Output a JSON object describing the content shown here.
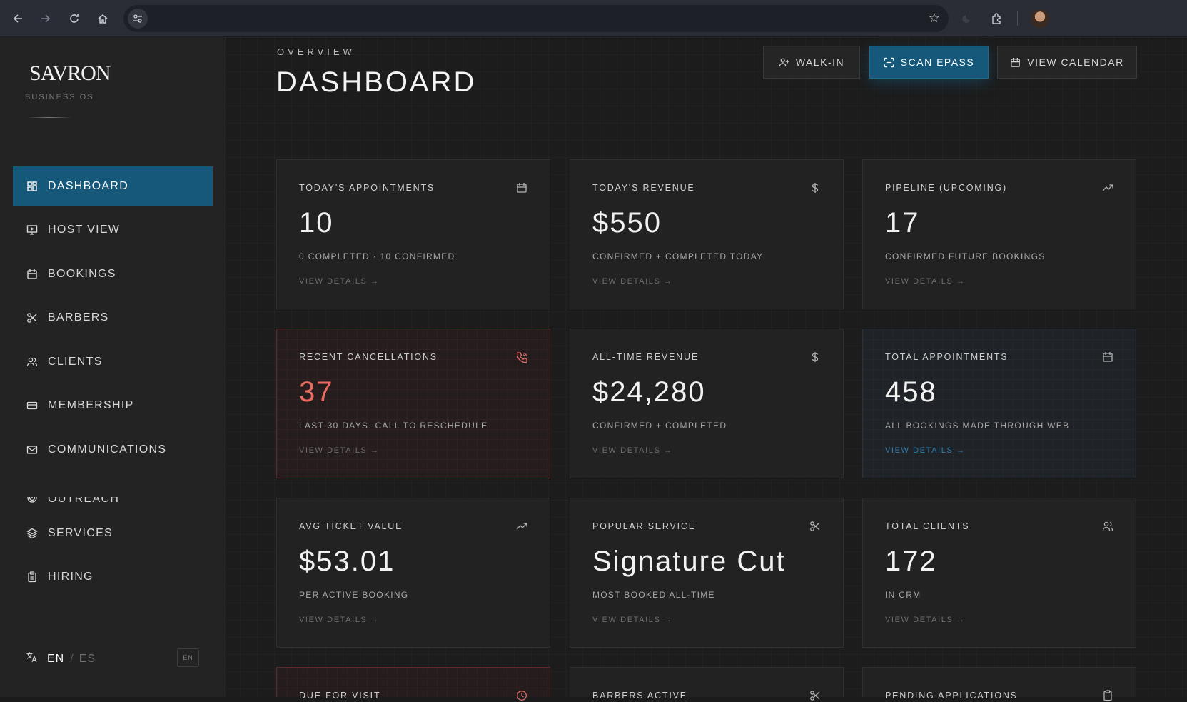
{
  "sidebar": {
    "brand": "SAVRON",
    "brand_sub": "BUSINESS OS",
    "items": [
      {
        "label": "DASHBOARD",
        "icon": "grid-icon",
        "active": true
      },
      {
        "label": "HOST VIEW",
        "icon": "monitor-play-icon"
      },
      {
        "label": "BOOKINGS",
        "icon": "calendar-icon"
      },
      {
        "label": "BARBERS",
        "icon": "scissors-icon"
      },
      {
        "label": "CLIENTS",
        "icon": "users-icon"
      },
      {
        "label": "MEMBERSHIP",
        "icon": "card-icon"
      },
      {
        "label": "COMMUNICATIONS",
        "icon": "mail-icon"
      },
      {
        "label": "OUTREACH",
        "icon": "target-icon"
      },
      {
        "label": "SERVICES",
        "icon": "layers-icon"
      },
      {
        "label": "HIRING",
        "icon": "clipboard-icon"
      }
    ],
    "lang": {
      "current": "EN",
      "separator": "/",
      "other": "ES",
      "badge": "EN"
    }
  },
  "header": {
    "eyebrow": "OVERVIEW",
    "title": "DASHBOARD",
    "buttons": {
      "walk_in": "WALK-IN",
      "scan": "SCAN EPASS",
      "calendar": "VIEW CALENDAR"
    }
  },
  "cards": [
    {
      "label": "TODAY'S APPOINTMENTS",
      "value": "10",
      "sub": "0 COMPLETED · 10 CONFIRMED",
      "link": "VIEW DETAILS →",
      "icon": "calendar-icon"
    },
    {
      "label": "TODAY'S REVENUE",
      "value": "$550",
      "sub": "CONFIRMED + COMPLETED TODAY",
      "link": "VIEW DETAILS →",
      "icon": "dollar-icon"
    },
    {
      "label": "PIPELINE (UPCOMING)",
      "value": "17",
      "sub": "CONFIRMED FUTURE BOOKINGS",
      "link": "VIEW DETAILS →",
      "icon": "trending-up-icon"
    },
    {
      "label": "RECENT CANCELLATIONS",
      "value": "37",
      "sub": "LAST 30 DAYS. CALL TO RESCHEDULE",
      "link": "VIEW DETAILS →",
      "icon": "phone-icon"
    },
    {
      "label": "ALL-TIME REVENUE",
      "value": "$24,280",
      "sub": "CONFIRMED + COMPLETED",
      "link": "VIEW DETAILS →",
      "icon": "dollar-icon"
    },
    {
      "label": "TOTAL APPOINTMENTS",
      "value": "458",
      "sub": "ALL BOOKINGS MADE THROUGH WEB",
      "link": "VIEW DETAILS →",
      "icon": "calendar-icon"
    },
    {
      "label": "AVG TICKET VALUE",
      "value": "$53.01",
      "sub": "PER ACTIVE BOOKING",
      "link": "VIEW DETAILS →",
      "icon": "trending-up-icon"
    },
    {
      "label": "POPULAR SERVICE",
      "value": "Signature Cut",
      "sub": "MOST BOOKED ALL-TIME",
      "link": "VIEW DETAILS →",
      "icon": "scissors-icon"
    },
    {
      "label": "TOTAL CLIENTS",
      "value": "172",
      "sub": "IN CRM",
      "link": "VIEW DETAILS →",
      "icon": "users-icon"
    },
    {
      "label": "DUE FOR VISIT",
      "icon": "clock-icon"
    },
    {
      "label": "BARBERS ACTIVE",
      "icon": "scissors-icon"
    },
    {
      "label": "PENDING APPLICATIONS",
      "icon": "clipboard-icon"
    }
  ],
  "colors": {
    "accent": "#15587a",
    "alert": "#ea6b62",
    "link_accent": "#2f7fae",
    "background": "#1c1c1c"
  }
}
